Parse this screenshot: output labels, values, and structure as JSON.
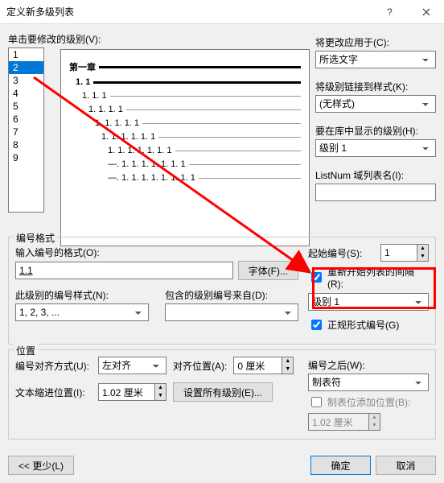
{
  "title": "定义新多级列表",
  "levels_label": "单击要修改的级别(V):",
  "levels": [
    "1",
    "2",
    "3",
    "4",
    "5",
    "6",
    "7",
    "8",
    "9"
  ],
  "selected_level": "2",
  "preview": {
    "items": [
      {
        "num": "第一章",
        "bold": true,
        "indent": 0
      },
      {
        "num": "1. 1",
        "bold": true,
        "indent": 1
      },
      {
        "num": "1. 1. 1",
        "bold": false,
        "indent": 2,
        "gray": true
      },
      {
        "num": "1. 1. 1. 1",
        "bold": false,
        "indent": 3,
        "gray": true
      },
      {
        "num": "1. 1. 1. 1. 1",
        "bold": false,
        "indent": 4,
        "gray": true
      },
      {
        "num": "1. 1. 1. 1. 1. 1",
        "bold": false,
        "indent": 5,
        "gray": true
      },
      {
        "num": "1. 1. 1. 1. 1. 1. 1",
        "bold": false,
        "indent": 6,
        "gray": true
      },
      {
        "num": "—. 1. 1. 1. 1. 1. 1. 1",
        "bold": false,
        "indent": 6,
        "gray": true
      },
      {
        "num": "—. 1. 1. 1. 1. 1. 1. 1. 1",
        "bold": false,
        "indent": 6,
        "gray": true
      }
    ]
  },
  "right": {
    "apply_to_label": "将更改应用于(C):",
    "apply_to_value": "所选文字",
    "link_style_label": "将级别链接到样式(K):",
    "link_style_value": "(无样式)",
    "gallery_show_label": "要在库中显示的级别(H):",
    "gallery_show_value": "级别 1",
    "listnum_label": "ListNum 域列表名(I):",
    "listnum_value": ""
  },
  "numfmt": {
    "legend": "编号格式",
    "enter_fmt_label": "输入编号的格式(O):",
    "enter_fmt_value": "1.1",
    "font_btn": "字体(F)...",
    "style_label": "此级别的编号样式(N):",
    "style_value": "1, 2, 3, ...",
    "include_label": "包含的级别编号来自(D):",
    "include_value": "",
    "start_at_label": "起始编号(S):",
    "start_at_value": "1",
    "restart_chk": "重新开始列表的间隔(R):",
    "restart_value": "级别 1",
    "legal_chk": "正规形式编号(G)"
  },
  "pos": {
    "legend": "位置",
    "align_label": "编号对齐方式(U):",
    "align_value": "左对齐",
    "align_at_label": "对齐位置(A):",
    "align_at_value": "0 厘米",
    "indent_label": "文本缩进位置(I):",
    "indent_value": "1.02 厘米",
    "set_all_btn": "设置所有级别(E)...",
    "follow_label": "编号之后(W):",
    "follow_value": "制表符",
    "tab_chk": "制表位添加位置(B):",
    "tab_value": "1.02 厘米"
  },
  "footer": {
    "less": "<< 更少(L)",
    "ok": "确定",
    "cancel": "取消"
  }
}
